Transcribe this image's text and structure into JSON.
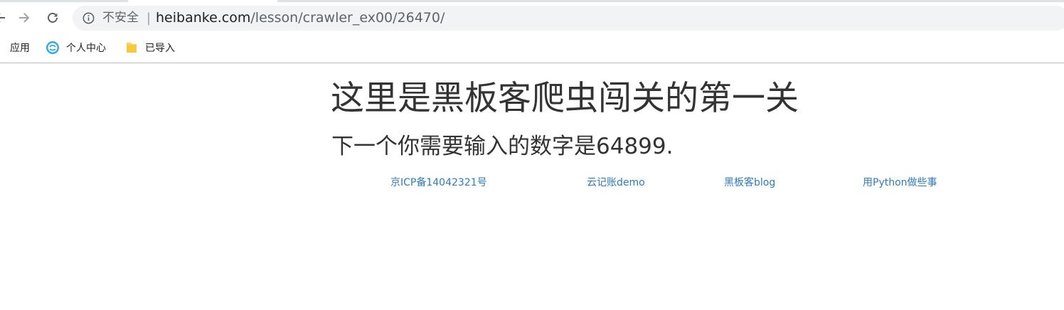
{
  "browser": {
    "security_label": "不安全",
    "separator": "|",
    "url_host": "heibanke.com",
    "url_path": "/lesson/crawler_ex00/26470/",
    "bookmarks": [
      {
        "label": "应用",
        "icon": "apps-grid-icon"
      },
      {
        "label": "个人中心",
        "icon": "site-favicon-icon"
      },
      {
        "label": "已导入",
        "icon": "folder-icon"
      }
    ]
  },
  "page": {
    "heading": "这里是黑板客爬虫闯关的第一关",
    "subheading": "下一个你需要输入的数字是64899.",
    "footer_links": [
      {
        "label": "京ICP备14042321号"
      },
      {
        "label": "云记账demo"
      },
      {
        "label": "黑板客blog"
      },
      {
        "label": "用Python做些事"
      }
    ],
    "link_color": "#337ab7",
    "text_color": "#333333"
  }
}
